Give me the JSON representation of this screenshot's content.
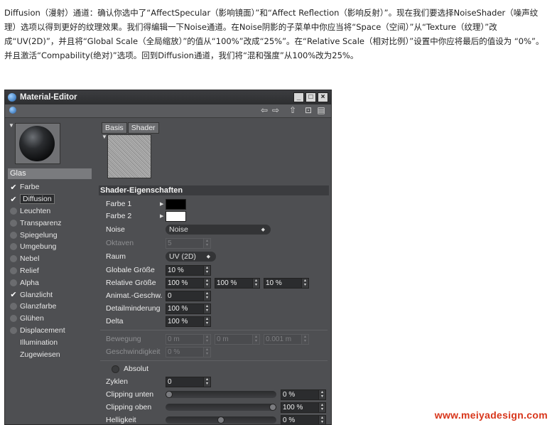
{
  "article": {
    "text": "Diffusion（漫射）通道：确认你选中了“AffectSpecular（影响镜面）”和“Affect Reflection（影响反射）”。现在我们要选择NoiseShader（噪声纹理）选项以得到更好的纹理效果。我们得编辑一下Noise通道。在Noise阴影的子菜单中你应当将“Space（空间）”从“Texture（纹理）”改成“UV(2D)”，并且将“Global Scale（全局缩放）”的值从“100%”改成“25%”。在“Relative Scale（相对比例）”设置中你应将最后的值设为 “0%”。并且激活“Compability(绝对)”选项。回到Diffusion通道，我们将“混和强度”从100%改为25%。"
  },
  "window": {
    "title": "Material-Editor",
    "material_name": "Glas",
    "channels": [
      {
        "label": "Farbe",
        "checked": true
      },
      {
        "label": "Diffusion",
        "checked": true,
        "selected": true
      },
      {
        "label": "Leuchten",
        "checked": false
      },
      {
        "label": "Transparenz",
        "checked": false
      },
      {
        "label": "Spiegelung",
        "checked": false
      },
      {
        "label": "Umgebung",
        "checked": false
      },
      {
        "label": "Nebel",
        "checked": false
      },
      {
        "label": "Relief",
        "checked": false
      },
      {
        "label": "Alpha",
        "checked": false
      },
      {
        "label": "Glanzlicht",
        "checked": true
      },
      {
        "label": "Glanzfarbe",
        "checked": false
      },
      {
        "label": "Glühen",
        "checked": false
      },
      {
        "label": "Displacement",
        "checked": false
      },
      {
        "label": "Illumination",
        "checked": null
      },
      {
        "label": "Zugewiesen",
        "checked": null
      }
    ],
    "tabs": [
      "Basis",
      "Shader"
    ],
    "section_title": "Shader-Eigenschaften",
    "colors": {
      "farbe1": "#000000",
      "farbe2": "#ffffff"
    },
    "fields": {
      "farbe1_label": "Farbe 1",
      "farbe2_label": "Farbe 2",
      "noise_label": "Noise",
      "noise_value": "Noise",
      "oktaven_label": "Oktaven",
      "oktaven_value": "5",
      "raum_label": "Raum",
      "raum_value": "UV (2D)",
      "globale_label": "Globale Größe",
      "globale_value": "10 %",
      "relative_label": "Relative Größe",
      "relative_values": [
        "100 %",
        "100 %",
        "10 %"
      ],
      "animat_label": "Animat.-Geschw.",
      "animat_value": "0",
      "detail_label": "Detailminderung",
      "detail_value": "100 %",
      "delta_label": "Delta",
      "delta_value": "100 %",
      "bewegung_label": "Bewegung",
      "bewegung_values": [
        "0 m",
        "0 m",
        "0.001 m"
      ],
      "geschw_label": "Geschwindigkeit",
      "geschw_value": "0 %",
      "absolut_label": "Absolut",
      "zyklen_label": "Zyklen",
      "zyklen_value": "0",
      "clip_unten_label": "Clipping unten",
      "clip_unten_value": "0 %",
      "clip_unten_pos": 0.0,
      "clip_oben_label": "Clipping oben",
      "clip_oben_value": "100 %",
      "clip_oben_pos": 1.0,
      "helligkeit_label": "Helligkeit",
      "helligkeit_value": "0 %",
      "helligkeit_pos": 0.5
    }
  },
  "watermark": "www.meiyadesign.com"
}
